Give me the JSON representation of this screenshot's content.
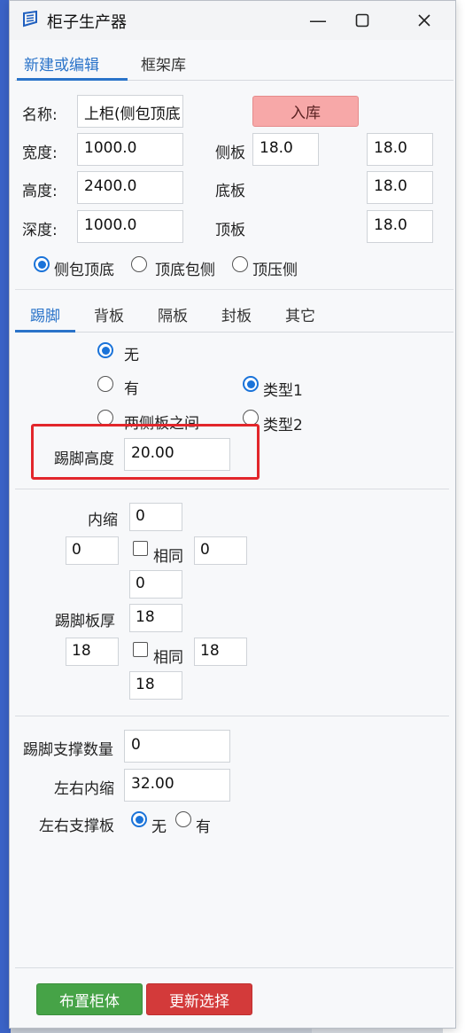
{
  "window": {
    "title": "柜子生产器",
    "controls": {
      "minimize": "—",
      "maximize": "☐",
      "close": "✕"
    }
  },
  "tabs": [
    {
      "label": "新建或编辑",
      "active": true
    },
    {
      "label": "框架库",
      "active": false
    }
  ],
  "form": {
    "name": {
      "label": "名称:",
      "value": "上柜(侧包顶底"
    },
    "store_button": "入库",
    "width": {
      "label": "宽度:",
      "value": "1000.0"
    },
    "height": {
      "label": "高度:",
      "value": "2400.0"
    },
    "depth": {
      "label": "深度:",
      "value": "1000.0"
    },
    "side_panel": {
      "label": "侧板",
      "value_left": "18.0",
      "value_right": "18.0"
    },
    "bottom_panel": {
      "label": "底板",
      "value": "18.0"
    },
    "top_panel": {
      "label": "顶板",
      "value": "18.0"
    },
    "wrap_options": [
      {
        "label": "侧包顶底",
        "checked": true
      },
      {
        "label": "顶底包侧",
        "checked": false
      },
      {
        "label": "顶压侧",
        "checked": false
      }
    ]
  },
  "subtabs": [
    {
      "label": "踢脚",
      "active": true
    },
    {
      "label": "背板",
      "active": false
    },
    {
      "label": "隔板",
      "active": false
    },
    {
      "label": "封板",
      "active": false
    },
    {
      "label": "其它",
      "active": false
    }
  ],
  "kick": {
    "mode_options": [
      {
        "label": "无",
        "checked": true
      },
      {
        "label": "有",
        "checked": false
      },
      {
        "label": "两侧板之间",
        "checked": false
      }
    ],
    "type_options": [
      {
        "label": "类型1",
        "checked": true
      },
      {
        "label": "类型2",
        "checked": false
      }
    ],
    "height": {
      "label": "踢脚高度",
      "value": "20.00"
    },
    "inset": {
      "label": "内缩",
      "top": "0",
      "left": "0",
      "right": "0",
      "bottom": "0",
      "same_label": "相同",
      "same_checked": false
    },
    "thickness": {
      "label": "踢脚板厚",
      "top": "18",
      "left": "18",
      "right": "18",
      "bottom": "18",
      "same_label": "相同",
      "same_checked": false
    },
    "support_count": {
      "label": "踢脚支撑数量",
      "value": "0"
    },
    "lr_inset": {
      "label": "左右内缩",
      "value": "32.00"
    },
    "lr_support": {
      "label": "左右支撑板",
      "options": [
        {
          "label": "无",
          "checked": true
        },
        {
          "label": "有",
          "checked": false
        }
      ]
    }
  },
  "buttons": {
    "place": "布置柜体",
    "update": "更新选择"
  },
  "colors": {
    "accent": "#2a73c9",
    "store_button": "#f7a8a8",
    "place_button": "#46a347",
    "update_button": "#d33a3a",
    "highlight_border": "#e2262b"
  }
}
